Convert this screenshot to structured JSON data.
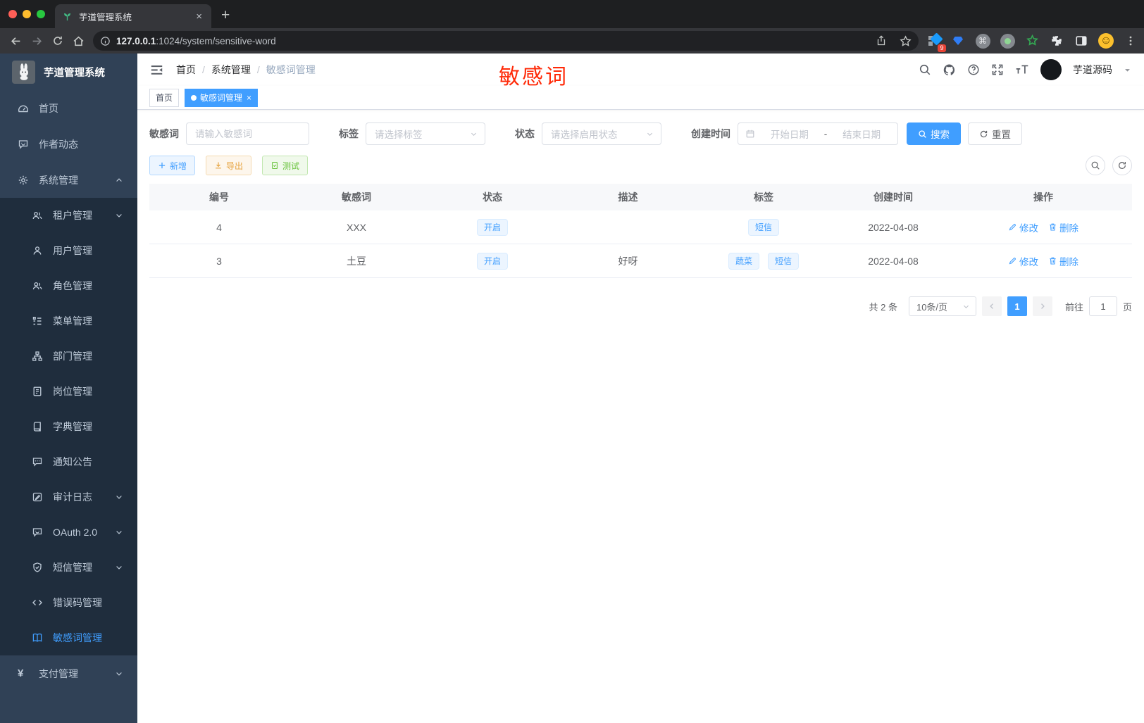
{
  "browser": {
    "tab_title": "芋道管理系统",
    "tab_close": "×",
    "new_tab": "+",
    "url_host": "127.0.0.1",
    "url_rest": ":1024/system/sensitive-word",
    "ext_badge": "9"
  },
  "icons": {
    "cmd": "⌘",
    "smiley": "☺",
    "yen": "¥"
  },
  "sidebar": {
    "title": "芋道管理系统",
    "items": [
      {
        "label": "首页"
      },
      {
        "label": "作者动态"
      },
      {
        "label": "系统管理"
      },
      {
        "label": "租户管理"
      },
      {
        "label": "用户管理"
      },
      {
        "label": "角色管理"
      },
      {
        "label": "菜单管理"
      },
      {
        "label": "部门管理"
      },
      {
        "label": "岗位管理"
      },
      {
        "label": "字典管理"
      },
      {
        "label": "通知公告"
      },
      {
        "label": "审计日志"
      },
      {
        "label": "OAuth 2.0"
      },
      {
        "label": "短信管理"
      },
      {
        "label": "错误码管理"
      },
      {
        "label": "敏感词管理"
      },
      {
        "label": "支付管理"
      }
    ]
  },
  "header": {
    "breadcrumb": [
      "首页",
      "系统管理",
      "敏感词管理"
    ],
    "separator": "/",
    "username": "芋道源码"
  },
  "annotation": {
    "text": "敏感词"
  },
  "tags_view": {
    "home": "首页",
    "active": "敏感词管理",
    "close": "×"
  },
  "filters": {
    "keyword_label": "敏感词",
    "keyword_placeholder": "请输入敏感词",
    "tag_label": "标签",
    "tag_placeholder": "请选择标签",
    "status_label": "状态",
    "status_placeholder": "请选择启用状态",
    "date_label": "创建时间",
    "date_start": "开始日期",
    "date_separator": "-",
    "date_end": "结束日期",
    "search_label": "搜索",
    "reset_label": "重置"
  },
  "toolbar": {
    "add_label": "新增",
    "export_label": "导出",
    "test_label": "测试"
  },
  "table": {
    "headers": [
      "编号",
      "敏感词",
      "状态",
      "描述",
      "标签",
      "创建时间",
      "操作"
    ],
    "rows": [
      {
        "id": "4",
        "word": "XXX",
        "status": "开启",
        "desc": "",
        "tags": [
          "短信"
        ],
        "created": "2022-04-08",
        "edit": "修改",
        "delete": "删除"
      },
      {
        "id": "3",
        "word": "土豆",
        "status": "开启",
        "desc": "好呀",
        "tags": [
          "蔬菜",
          "短信"
        ],
        "created": "2022-04-08",
        "edit": "修改",
        "delete": "删除"
      }
    ]
  },
  "pagination": {
    "total": "共 2 条",
    "page_size": "10条/页",
    "current_page": "1",
    "goto_label": "前往",
    "goto_value": "1",
    "page_unit": "页"
  },
  "colors": {
    "primary": "#409eff",
    "warning": "#e6a23c",
    "success": "#67c23a",
    "annotation_red": "#ff2a08"
  }
}
